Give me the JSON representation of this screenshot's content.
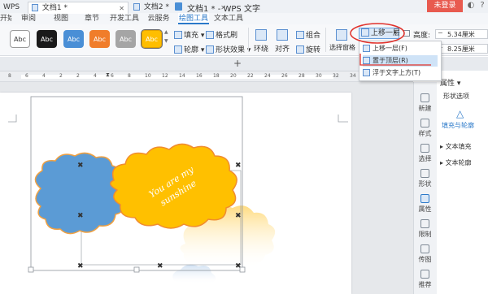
{
  "window": {
    "title": "文档1 * - WPS 文字",
    "login_button": "未登录"
  },
  "menu": {
    "tabs": [
      "开始",
      "审阅",
      "视图",
      "章节",
      "开发工具",
      "云服务",
      "绘图工具",
      "文本工具"
    ],
    "active": "绘图工具"
  },
  "ribbon": {
    "style_swatches": [
      {
        "label": "Abc",
        "bg": "#ffffff",
        "fg": "#333333",
        "border": "#999999"
      },
      {
        "label": "Abc",
        "bg": "#1a1a1a",
        "fg": "#ffffff",
        "border": "#1a1a1a"
      },
      {
        "label": "Abc",
        "bg": "#4a8fd6",
        "fg": "#ffffff",
        "border": "#4a8fd6"
      },
      {
        "label": "Abc",
        "bg": "#f07d2a",
        "fg": "#ffffff",
        "border": "#f07d2a"
      },
      {
        "label": "Abc",
        "bg": "#a5a5a5",
        "fg": "#ffffff",
        "border": "#a5a5a5"
      },
      {
        "label": "Abc",
        "bg": "#ffbe00",
        "fg": "#ffffff",
        "border": "#e0a000"
      }
    ],
    "fill_label": "填充",
    "format_painter_label": "格式刷",
    "outline_label": "轮廓",
    "shape_effect_label": "形状效果",
    "wrap_label": "环绕",
    "align_label": "对齐",
    "group_label": "组合",
    "rotate_label": "旋转",
    "selection_pane_label": "选择窗格",
    "bring_forward_label": "上移一层",
    "height_label": "高度:",
    "height_value": "5.34厘米",
    "width_value": "8.25厘米"
  },
  "dropdown": {
    "items": [
      "上移一层(F)",
      "置于顶层(R)",
      "浮于文字上方(T)"
    ],
    "highlighted": "置于顶层(R)"
  },
  "doc_tabs": [
    {
      "label": "WPS",
      "active": false
    },
    {
      "label": "文档1 *",
      "active": true
    },
    {
      "label": "文档2 *",
      "active": false
    }
  ],
  "ruler": {
    "numbers": [
      "8",
      "6",
      "4",
      "2",
      "2",
      "4",
      "6",
      "8",
      "10",
      "12",
      "14",
      "16",
      "18",
      "20",
      "22",
      "24",
      "26",
      "28",
      "30",
      "32",
      "34",
      "36",
      "38"
    ]
  },
  "canvas": {
    "cloud_text_line1": "You are my",
    "cloud_text_line2": "sunshine",
    "colors": {
      "blue_cloud": "#5b9bd5",
      "yellow_cloud": "#ffc000",
      "cloud_outline": "#f0a040"
    }
  },
  "side_strip": {
    "items": [
      {
        "label": "新建",
        "active": false
      },
      {
        "label": "样式",
        "active": false
      },
      {
        "label": "选择",
        "active": false
      },
      {
        "label": "形状",
        "active": false
      },
      {
        "label": "属性",
        "active": true
      },
      {
        "label": "限制",
        "active": false
      },
      {
        "label": "传图",
        "active": false
      },
      {
        "label": "推荐",
        "active": false
      }
    ]
  },
  "properties": {
    "title": "属性",
    "tab_shape_options": "形状选项",
    "tab_fill_outline": "填充与轮廓",
    "section_text_fill": "文本填充",
    "section_text_outline": "文本轮廓"
  }
}
